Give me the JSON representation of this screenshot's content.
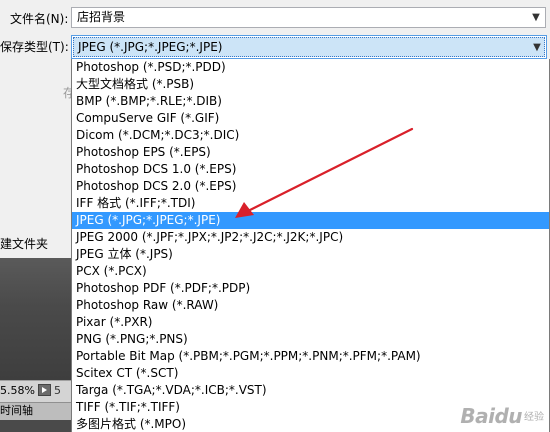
{
  "form": {
    "filename_label": "文件名(N):",
    "filename_value": "店招背景",
    "filetype_label": "保存类型(T):",
    "filetype_value": "JPEG (*.JPG;*.JPEG;*.JPE)"
  },
  "background": {
    "partial_glyph": "存",
    "folder_label": "建文件夹",
    "zoom_value": "5.58%",
    "zoom_trailing": "5",
    "timeline_tab": "时间轴"
  },
  "file_types": [
    "Photoshop (*.PSD;*.PDD)",
    "大型文档格式 (*.PSB)",
    "BMP (*.BMP;*.RLE;*.DIB)",
    "CompuServe GIF (*.GIF)",
    "Dicom (*.DCM;*.DC3;*.DIC)",
    "Photoshop EPS (*.EPS)",
    "Photoshop DCS 1.0 (*.EPS)",
    "Photoshop DCS 2.0 (*.EPS)",
    "IFF 格式 (*.IFF;*.TDI)",
    "JPEG (*.JPG;*.JPEG;*.JPE)",
    "JPEG 2000 (*.JPF;*.JPX;*.JP2;*.J2C;*.J2K;*.JPC)",
    "JPEG 立体 (*.JPS)",
    "PCX (*.PCX)",
    "Photoshop PDF (*.PDF;*.PDP)",
    "Photoshop Raw (*.RAW)",
    "Pixar (*.PXR)",
    "PNG (*.PNG;*.PNS)",
    "Portable Bit Map (*.PBM;*.PGM;*.PPM;*.PNM;*.PFM;*.PAM)",
    "Scitex CT (*.SCT)",
    "Targa (*.TGA;*.VDA;*.ICB;*.VST)",
    "TIFF (*.TIF;*.TIFF)",
    "多图片格式 (*.MPO)"
  ],
  "selected_index": 9,
  "colors": {
    "selection": "#3399ff",
    "annotation_arrow": "#d9202a",
    "combo_highlight": "#cce4f7"
  },
  "icons": {
    "dropdown": "chevron-down-icon",
    "annotation": "red-arrow-icon",
    "zoom": "play-icon"
  },
  "watermark": {
    "text": "Baidu",
    "sub": "经验"
  }
}
